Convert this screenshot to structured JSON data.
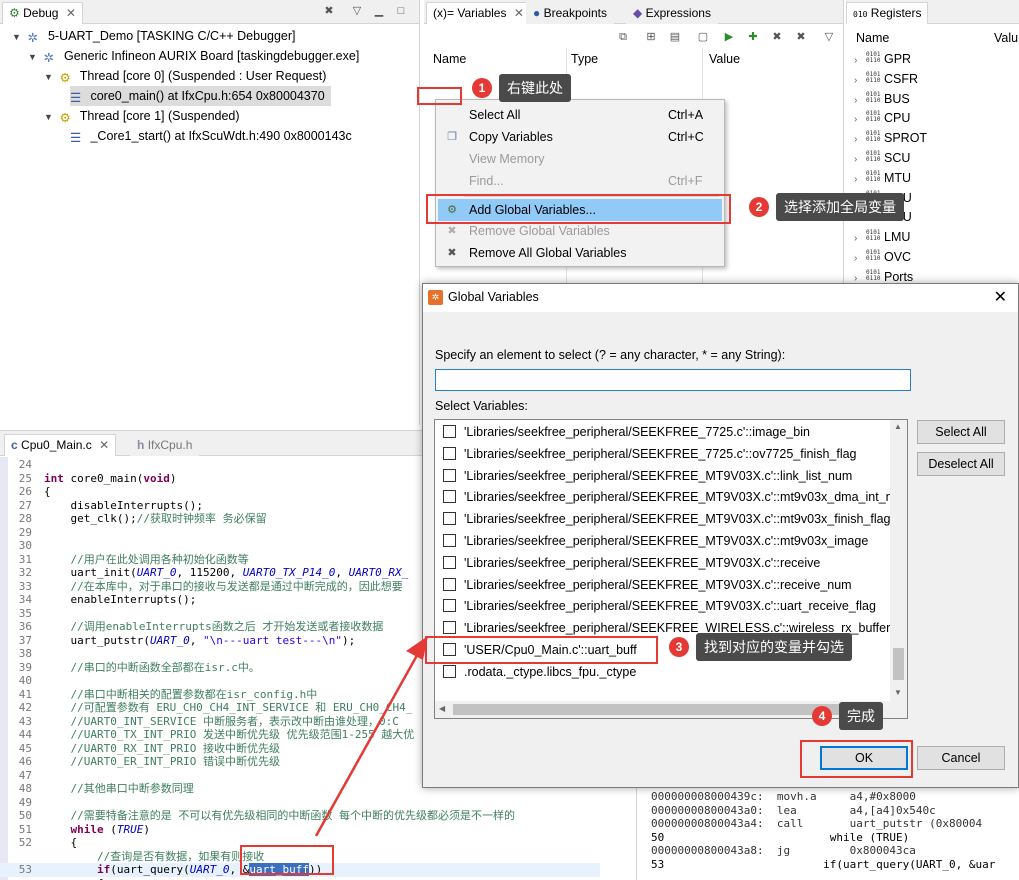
{
  "debug_view": {
    "tab_label": "Debug",
    "tree": [
      "5-UART_Demo [TASKING C/C++ Debugger]",
      "Generic Infineon AURIX Board [taskingdebugger.exe]",
      "Thread [core 0] (Suspended : User Request)",
      "core0_main() at IfxCpu.h:654 0x80004370",
      "Thread [core 1] (Suspended)",
      "_Core1_start() at IfxScuWdt.h:490 0x8000143c"
    ]
  },
  "variables_view": {
    "tabs": [
      "(x)= Variables",
      "Breakpoints",
      "Expressions"
    ],
    "columns": [
      "Name",
      "Type",
      "Value"
    ]
  },
  "registers_view": {
    "tab_label": "Registers",
    "columns": [
      "Name",
      "Valu"
    ],
    "items": [
      "GPR",
      "CSFR",
      "BUS",
      "CPU",
      "SPROT",
      "SCU",
      "MTU",
      "SMU",
      "PMU",
      "LMU",
      "OVC",
      "Ports"
    ]
  },
  "context_menu": {
    "items": [
      {
        "label": "Select All",
        "accel": "Ctrl+A",
        "enabled": true
      },
      {
        "label": "Copy Variables",
        "accel": "Ctrl+C",
        "enabled": true
      },
      {
        "label": "View Memory",
        "accel": "",
        "enabled": false
      },
      {
        "label": "Find...",
        "accel": "Ctrl+F",
        "enabled": false
      },
      {
        "label": "Add Global Variables...",
        "accel": "",
        "enabled": true,
        "highlighted": true
      },
      {
        "label": "Remove Global Variables",
        "accel": "",
        "enabled": false
      },
      {
        "label": "Remove All Global Variables",
        "accel": "",
        "enabled": true
      }
    ]
  },
  "editor": {
    "tabs": [
      "Cpu0_Main.c",
      "IfxCpu.h"
    ],
    "lines": [
      {
        "n": "24",
        "t": ""
      },
      {
        "n": "25",
        "t": "int core0_main(void)"
      },
      {
        "n": "26",
        "t": "{"
      },
      {
        "n": "27",
        "t": "    disableInterrupts();"
      },
      {
        "n": "28",
        "t": "    get_clk();//获取时钟频率 务必保留"
      },
      {
        "n": "29",
        "t": ""
      },
      {
        "n": "30",
        "t": ""
      },
      {
        "n": "31",
        "t": "    //用户在此处调用各种初始化函数等"
      },
      {
        "n": "32",
        "t": "    uart_init(UART_0, 115200, UART0_TX_P14_0, UART0_RX_"
      },
      {
        "n": "33",
        "t": "    //在本库中，对于串口的接收与发送都是通过中断完成的，因此想要"
      },
      {
        "n": "34",
        "t": "    enableInterrupts();"
      },
      {
        "n": "35",
        "t": ""
      },
      {
        "n": "36",
        "t": "    //调用enableInterrupts函数之后 才开始发送或者接收数据"
      },
      {
        "n": "37",
        "t": "    uart_putstr(UART_0, \"\\n---uart test---\\n\");"
      },
      {
        "n": "38",
        "t": ""
      },
      {
        "n": "39",
        "t": "    //串口的中断函数全部都在isr.c中。"
      },
      {
        "n": "40",
        "t": ""
      },
      {
        "n": "41",
        "t": "    //串口中断相关的配置参数都在isr_config.h中"
      },
      {
        "n": "42",
        "t": "    //可配置参数有 ERU_CH0_CH4_INT_SERVICE 和 ERU_CH0_CH4_"
      },
      {
        "n": "43",
        "t": "    //UART0_INT_SERVICE 中断服务者，表示改中断由谁处理，0:C"
      },
      {
        "n": "44",
        "t": "    //UART0_TX_INT_PRIO 发送中断优先级 优先级范围1-255 越大优"
      },
      {
        "n": "45",
        "t": "    //UART0_RX_INT_PRIO 接收中断优先级"
      },
      {
        "n": "46",
        "t": "    //UART0_ER_INT_PRIO 错误中断优先级"
      },
      {
        "n": "47",
        "t": ""
      },
      {
        "n": "48",
        "t": "    //其他串口中断参数同理"
      },
      {
        "n": "49",
        "t": ""
      },
      {
        "n": "50",
        "t": "    //需要特备注意的是 不可以有优先级相同的中断函数 每个中断的优先级都必须是不一样的"
      },
      {
        "n": "51",
        "t": "    while (TRUE)"
      },
      {
        "n": "52",
        "t": "    {"
      },
      {
        "n": "",
        "t": "        //查询是否有数据，如果有则接收"
      },
      {
        "n": "53",
        "t": "        if(uart_query(UART_0, &uart_buff))"
      },
      {
        "n": "",
        "t": "        {"
      }
    ]
  },
  "disassembly": {
    "lines": [
      "000000008000439c:  movh.a     a4,#0x8000",
      "00000000800043a0:  lea        a4,[a4]0x540c",
      "00000000800043a4:  call       uart_putstr (0x80004",
      "50                         while (TRUE)",
      "00000000800043a8:  jg         0x800043ca",
      "53                        if(uart_query(UART_0, &uar"
    ]
  },
  "dialog": {
    "title": "Global Variables",
    "filter_label": "Specify an element to select (? = any character, * = any String):",
    "filter_value": "",
    "list_label": "Select Variables:",
    "items": [
      "'Libraries/seekfree_peripheral/SEEKFREE_7725.c'::image_bin",
      "'Libraries/seekfree_peripheral/SEEKFREE_7725.c'::ov7725_finish_flag",
      "'Libraries/seekfree_peripheral/SEEKFREE_MT9V03X.c'::link_list_num",
      "'Libraries/seekfree_peripheral/SEEKFREE_MT9V03X.c'::mt9v03x_dma_int_nu",
      "'Libraries/seekfree_peripheral/SEEKFREE_MT9V03X.c'::mt9v03x_finish_flag",
      "'Libraries/seekfree_peripheral/SEEKFREE_MT9V03X.c'::mt9v03x_image",
      "'Libraries/seekfree_peripheral/SEEKFREE_MT9V03X.c'::receive",
      "'Libraries/seekfree_peripheral/SEEKFREE_MT9V03X.c'::receive_num",
      "'Libraries/seekfree_peripheral/SEEKFREE_MT9V03X.c'::uart_receive_flag",
      "'Libraries/seekfree_peripheral/SEEKFREE_WIRELESS.c'::wireless_rx_buffer",
      "'USER/Cpu0_Main.c'::uart_buff",
      ".rodata._ctype.libcs_fpu._ctype"
    ],
    "buttons": {
      "select_all": "Select All",
      "deselect_all": "Deselect All",
      "ok": "OK",
      "cancel": "Cancel"
    }
  },
  "annotations": [
    {
      "num": "1",
      "text": "右键此处"
    },
    {
      "num": "2",
      "text": "选择添加全局变量"
    },
    {
      "num": "3",
      "text": "找到对应的变量并勾选"
    },
    {
      "num": "4",
      "text": "完成"
    }
  ],
  "colors": {
    "annotation_red": "#e53935",
    "menu_highlight": "#91c9f7",
    "callout_bg": "#4a4a4a"
  }
}
